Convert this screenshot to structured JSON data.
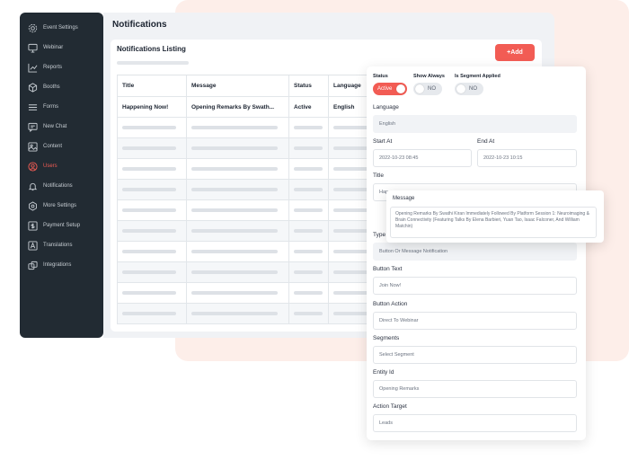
{
  "sidebar": {
    "items": [
      {
        "label": "Event Settings",
        "icon": "gear-icon"
      },
      {
        "label": "Webinar",
        "icon": "monitor-icon"
      },
      {
        "label": "Reports",
        "icon": "chart-icon"
      },
      {
        "label": "Booths",
        "icon": "cube-icon"
      },
      {
        "label": "Forms",
        "icon": "list-icon"
      },
      {
        "label": "New Chat",
        "icon": "chat-icon"
      },
      {
        "label": "Content",
        "icon": "image-icon"
      },
      {
        "label": "Users",
        "icon": "user-icon",
        "active": true
      },
      {
        "label": "Notifications",
        "icon": "bell-icon"
      },
      {
        "label": "More Settings",
        "icon": "settings-icon"
      },
      {
        "label": "Payment Setup",
        "icon": "dollar-icon"
      },
      {
        "label": "Translations",
        "icon": "translate-icon"
      },
      {
        "label": "Integrations",
        "icon": "integrations-icon"
      }
    ]
  },
  "header": {
    "title": "Notifications"
  },
  "listing": {
    "title": "Notifications Listing",
    "add_label": "+Add",
    "columns": [
      "Title",
      "Message",
      "Status",
      "Language"
    ],
    "first_row": [
      "Happening Now!",
      "Opening Remarks By Swath...",
      "Active",
      "English"
    ]
  },
  "form": {
    "status_label": "Status",
    "status_value": "Active",
    "show_always_label": "Show Always",
    "show_always_value": "NO",
    "segment_label": "Is Segment Applied",
    "segment_value": "NO",
    "language_label": "Language",
    "language_value": "English",
    "start_label": "Start At",
    "start_value": "2022-10-23 08:45",
    "end_label": "End At",
    "end_value": "2022-10-23 10:15",
    "title_label": "Title",
    "title_value": "Hap",
    "type_label": "Type",
    "type_value": "Button Or Message Notification",
    "button_text_label": "Button Text",
    "button_text_value": "Join Now!",
    "button_action_label": "Button Action",
    "button_action_value": "Direct To Webinar",
    "segments_label": "Segments",
    "segments_placeholder": "Select Segment",
    "entity_label": "Entity Id",
    "entity_value": "Opening Remarks",
    "action_target_label": "Action Target",
    "action_target_value": "Leads"
  },
  "popup": {
    "label": "Message",
    "text": "Opening Remarks By Swathi Kiran Immediately Followed By Platform Session 1: Neuroimaging & Brain Connectivity (Featuring Talks By Elena Barbieri, Yuan Tao, Isaac Falconer, And William Matchin)"
  },
  "colors": {
    "accent": "#f25c54",
    "sidebar": "#222b33",
    "peach": "#fdeee9"
  }
}
